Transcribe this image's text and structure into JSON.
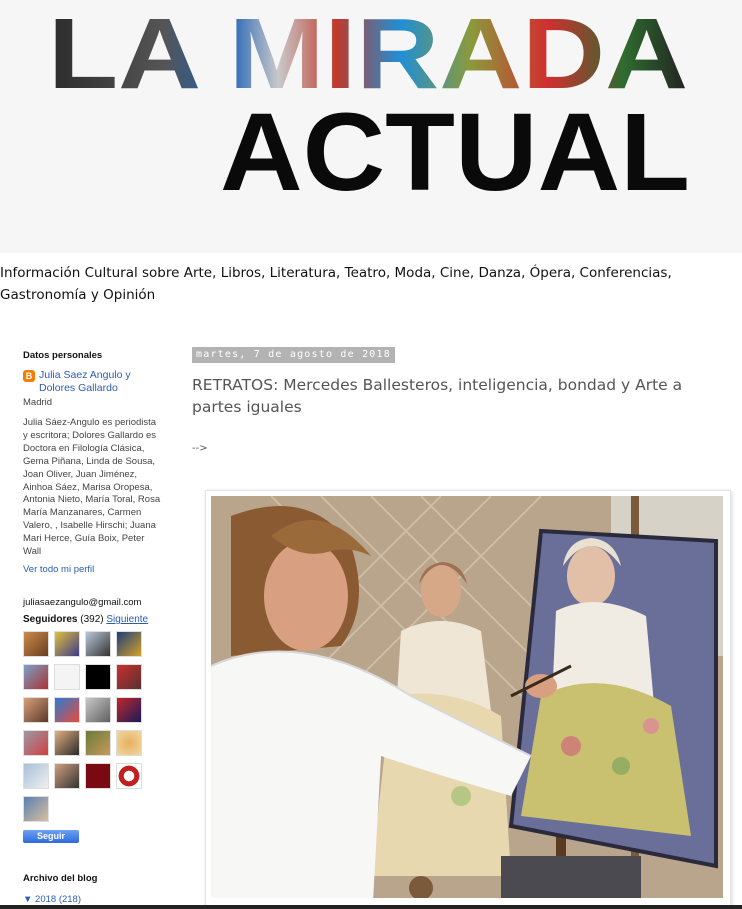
{
  "header": {
    "title_line1": "LA MIRADA",
    "title_line2": "ACTUAL",
    "tagline": "Información Cultural sobre Arte, Libros, Literatura, Teatro, Moda, Cine, Danza, Ópera, Conferencias, Gastronomía y Opinión"
  },
  "sidebar": {
    "personal_heading": "Datos personales",
    "profile_name": "Julia Saez Angulo y Dolores Gallardo",
    "profile_location": "Madrid",
    "profile_bio": "Julia Sáez-Angulo es periodista y escritora; Dolores Gallardo es Doctora en Filología Clásica, Gema Piñana, Linda de Sousa, Joan Oliver, Juan Jiménez, Ainhoa Sáez, Marisa Oropesa, Antonia Nieto, María Toral, Rosa María Manzanares, Carmen Valero, , Isabelle Hirschi; Juana Mari Herce, Guía Boix, Peter Wall",
    "profile_link": "Ver todo mi perfil",
    "email": "juliasaezangulo@gmail.com",
    "followers_label": "Seguidores",
    "followers_count": "(392)",
    "followers_link": "Siguiente",
    "follow_button": "Seguir",
    "archive_heading": "Archivo del blog",
    "archive_year": "▼ 2018 (218)"
  },
  "post": {
    "date": "martes, 7 de agosto de 2018",
    "title": "RETRATOS: Mercedes Ballesteros, inteligencia, bondad y Arte a partes iguales",
    "arrow_text": "-->"
  },
  "colors": {
    "link": "#2a5db0",
    "date_bg": "#b3b3b3",
    "follow_button": "#2d6ae0",
    "blogger_orange": "#f57d00"
  }
}
